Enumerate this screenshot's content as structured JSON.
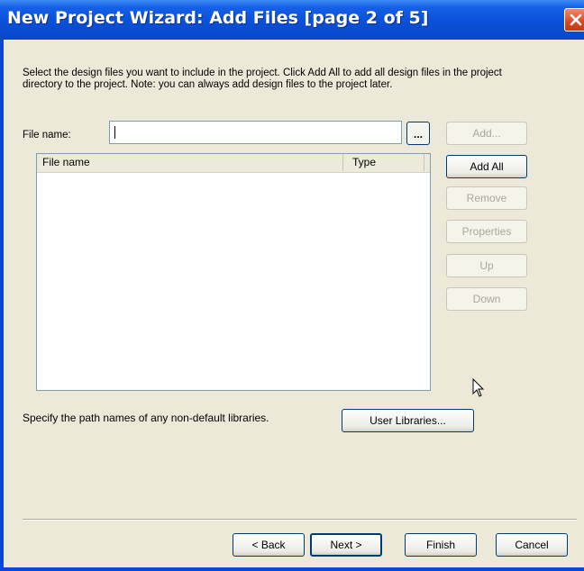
{
  "window": {
    "title": "New Project Wizard: Add Files [page 2 of 5]"
  },
  "description": "Select the design files you want to include in the project. Click Add All to add all design files in the project directory to the project. Note: you can always add design files to the project later.",
  "file_name": {
    "label": "File name:",
    "value": "",
    "browse_label": "..."
  },
  "file_list": {
    "columns": [
      "File name",
      "Type"
    ],
    "rows": []
  },
  "side_buttons": {
    "add": "Add...",
    "add_all": "Add All",
    "remove": "Remove",
    "properties": "Properties",
    "up": "Up",
    "down": "Down"
  },
  "libraries": {
    "text": "Specify the path names of any non-default libraries.",
    "button": "User Libraries..."
  },
  "footer": {
    "back": "< Back",
    "next": "Next >",
    "finish": "Finish",
    "cancel": "Cancel"
  },
  "colors": {
    "titlebar": "#0a50d8",
    "dialog_bg": "#ece9d8",
    "close_button": "#d8481e"
  },
  "icons": {
    "close": "close-x-icon",
    "cursor": "mouse-pointer-icon"
  }
}
